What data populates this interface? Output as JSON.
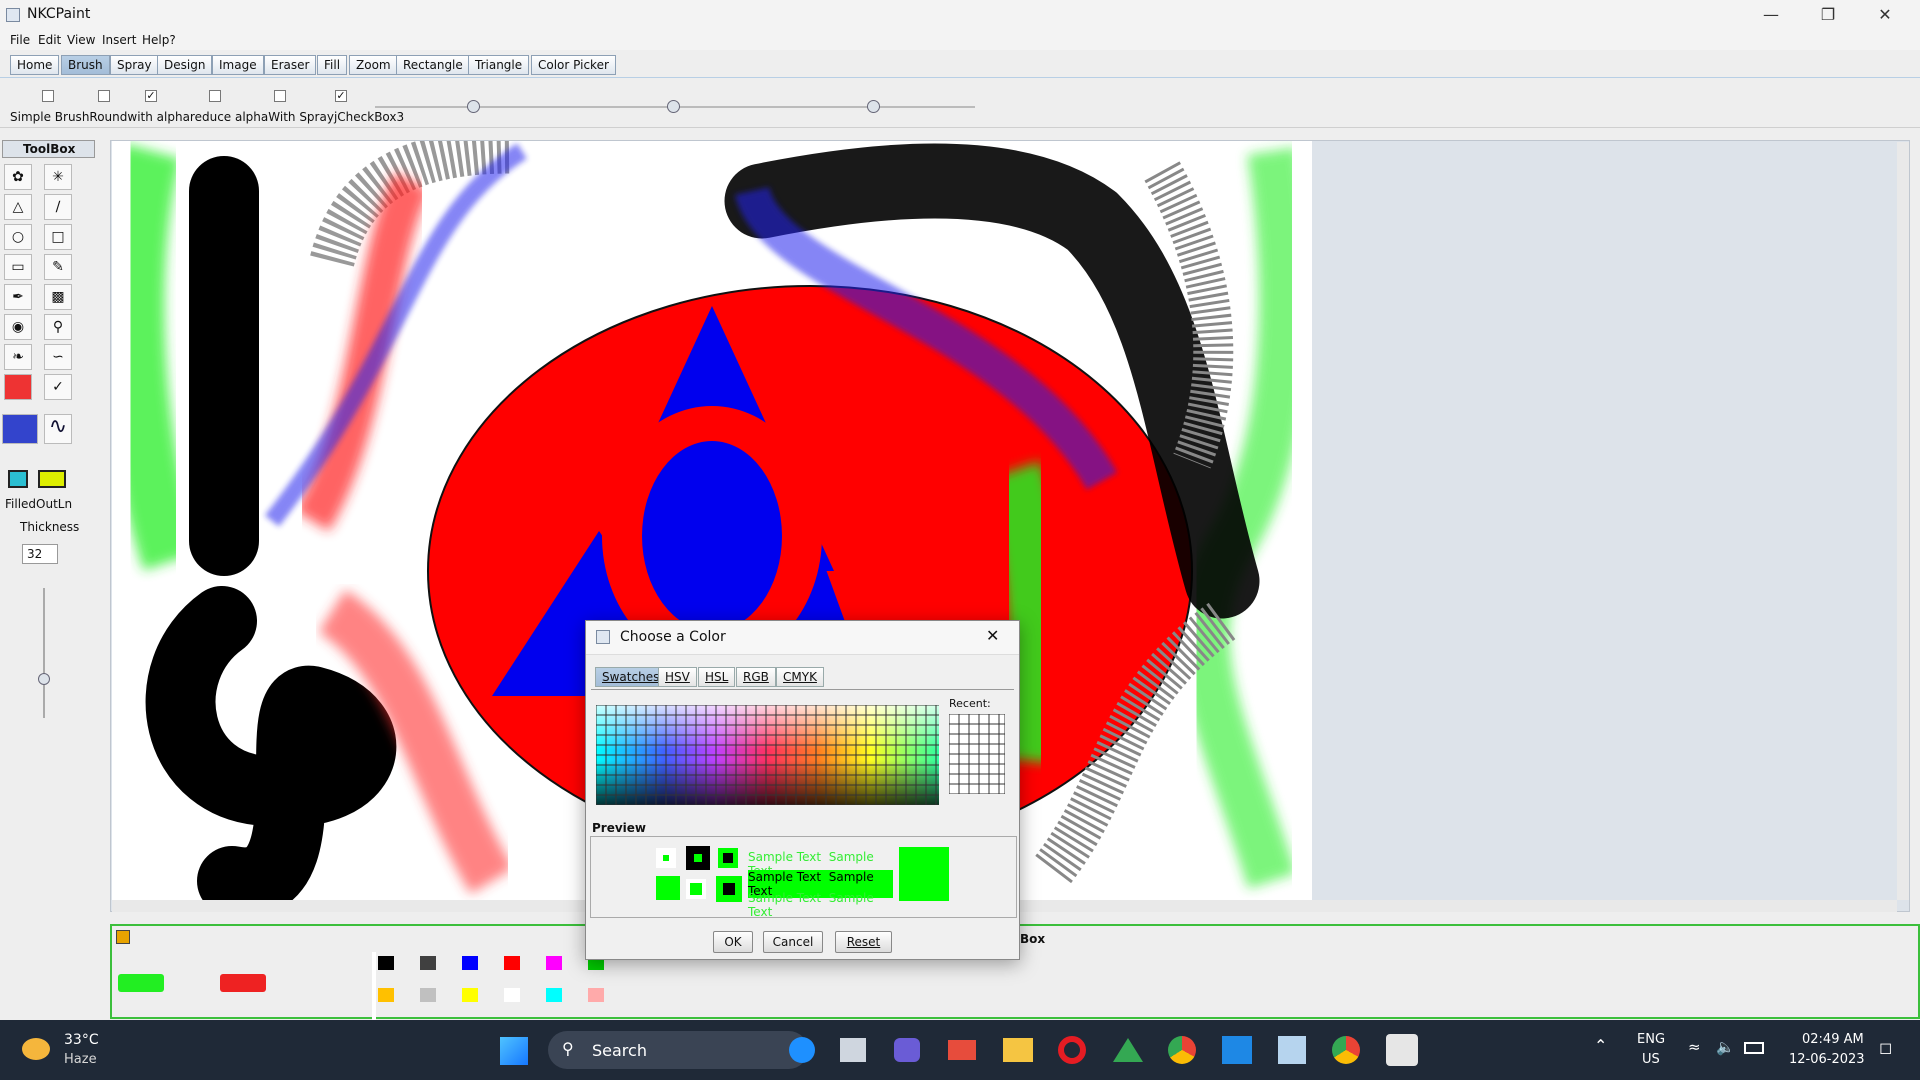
{
  "window": {
    "title": "NKCPaint",
    "minimize_icon": "minimize-icon",
    "maximize_icon": "restore-icon",
    "close_icon": "close-icon"
  },
  "menu": [
    "File",
    "Edit",
    "View",
    "Insert",
    "Help?"
  ],
  "tabs": [
    {
      "label": "Home",
      "active": false
    },
    {
      "label": "Brush",
      "active": true
    },
    {
      "label": "Spray",
      "active": false
    },
    {
      "label": "Design",
      "active": false
    },
    {
      "label": "Image",
      "active": false
    },
    {
      "label": "Eraser",
      "active": false
    },
    {
      "label": "Fill",
      "active": false
    },
    {
      "label": "Zoom",
      "active": false
    },
    {
      "label": "Rectangle",
      "active": false
    },
    {
      "label": "Triangle",
      "active": false
    },
    {
      "label": "Color Picker",
      "active": false
    }
  ],
  "options": {
    "labels_text": "Simple BrushRoundwith alphareduce alphaWith SprayjCheckBox3",
    "checkboxes": [
      false,
      false,
      true,
      false,
      false,
      true
    ],
    "sliders": [
      0.5,
      0.5,
      0.5
    ]
  },
  "toolbox": {
    "header": "ToolBox",
    "filled_outline_label": "FilledOutLn",
    "thickness_label": "Thickness",
    "thickness_value": "32"
  },
  "palette_panel": {
    "title_fragment": "Box",
    "primary_color": "#22ee22",
    "secondary_color": "#ee2222",
    "swatches_row1": [
      "#000000",
      "#404040",
      "#0000ff",
      "#ff0000",
      "#ff00ff",
      "#00cc00"
    ],
    "swatches_row2": [
      "#ffc000",
      "#c0c0c0",
      "#ffff00",
      "#ffffff",
      "#00ffff",
      "#ffaaaa"
    ]
  },
  "dialog": {
    "title": "Choose a Color",
    "tabs": [
      {
        "label": "Swatches",
        "active": true
      },
      {
        "label": "HSV",
        "active": false
      },
      {
        "label": "HSL",
        "active": false
      },
      {
        "label": "RGB",
        "active": false
      },
      {
        "label": "CMYK",
        "active": false
      }
    ],
    "recent_label": "Recent:",
    "preview_label": "Preview",
    "sample_text": "Sample Text",
    "selected_color": "#00ff00",
    "ok_label": "OK",
    "cancel_label": "Cancel",
    "reset_label": "Reset"
  },
  "taskbar": {
    "temperature": "33°C",
    "weather": "Haze",
    "search_placeholder": "Search",
    "language": "ENG",
    "region": "US",
    "time": "02:49 AM",
    "date": "12-06-2023"
  }
}
